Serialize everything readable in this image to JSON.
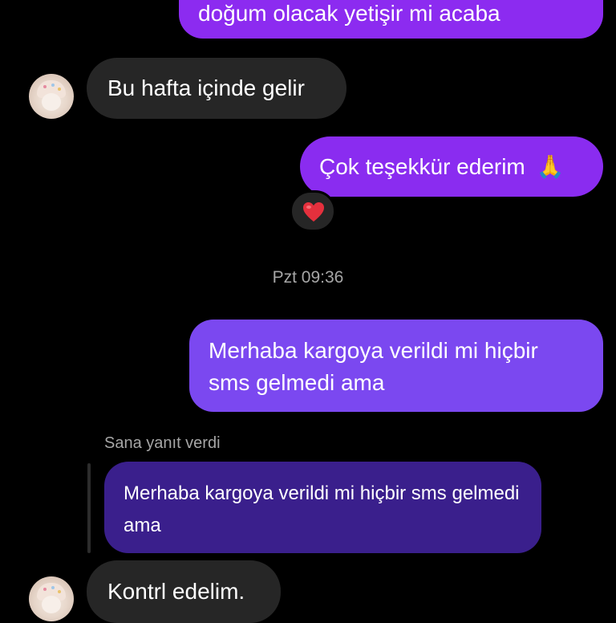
{
  "messages": {
    "out1": "doğum olacak yetişir mi acaba",
    "in1": "Bu hafta içinde gelir",
    "out2_text": "Çok teşekkür ederim",
    "out2_emoji": "🙏",
    "reaction_icon": "red-heart",
    "timestamp": "Pzt 09:36",
    "out3": "Merhaba kargoya verildi mi hiçbir sms gelmedi ama",
    "reply_label": "Sana yanıt verdi",
    "quoted": "Merhaba kargoya verildi mi hiçbir sms gelmedi ama",
    "in2": "Kontrl edelim."
  },
  "colors": {
    "outgoing_bubble": "#8c2bf0",
    "outgoing_bubble_2": "#7b48f0",
    "incoming_bubble": "#262626",
    "quoted_bubble": "#3a1f8c",
    "meta_text": "#a6a6a6"
  }
}
